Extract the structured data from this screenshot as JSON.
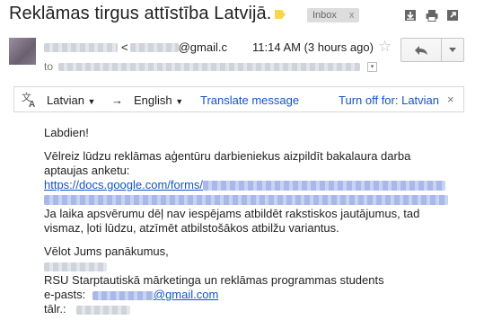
{
  "header": {
    "subject": "Reklāmas tirgus attīstība Latvijā.",
    "label_badge": "Inbox",
    "label_badge_remove": "x",
    "label_color": "#f8d74a"
  },
  "message": {
    "sender_email_bracket": "<",
    "sender_email_domain": "@gmail.c",
    "time": "11:14 AM (3 hours ago)",
    "to_label": "to"
  },
  "translate_bar": {
    "source_language": "Latvian",
    "target_language": "English",
    "translate_link": "Translate message",
    "turn_off_link": "Turn off for: Latvian",
    "close": "×"
  },
  "body": {
    "greeting": "Labdien!",
    "line1": "Vēlreiz lūdzu reklāmas aģentūru darbieniekus aizpildīt bakalaura darba",
    "line2": "aptaujas anketu:",
    "link_prefix": "https://docs.google.com/forms/",
    "line3": "Ja laika apsvērumu dēļ nav iespējams atbildēt rakstiskos jautājumus, tad",
    "line4": "vismaz, ļoti lūdzu, atzīmēt atbilstošākos atbilžu variantus.",
    "closing": "Vēlot Jums panākumus,",
    "signature_line": "RSU Starptautiskā mārketinga un reklāmas programmas students",
    "email_label": "e-pasts:",
    "email_domain": "@gmail.com",
    "phone_label": "tālr.:"
  },
  "icons": {
    "archive": "download-icon",
    "print": "print-icon",
    "expand": "new-window-icon",
    "star": "star-icon",
    "reply": "reply-icon",
    "more": "chevron-down-icon",
    "translate": "translate-icon"
  },
  "colors": {
    "link": "#1155cc",
    "badge_bg": "#dddddd"
  }
}
